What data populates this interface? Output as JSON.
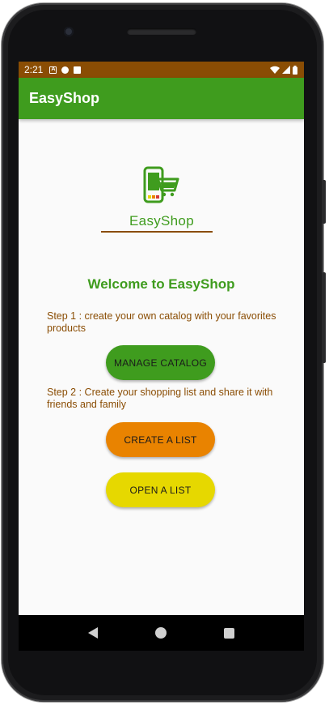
{
  "status_bar": {
    "time": "2:21",
    "icons": [
      "a-notification-icon",
      "p-notification-icon",
      "sd-card-icon",
      "wifi-icon",
      "signal-icon",
      "battery-icon"
    ]
  },
  "app_bar": {
    "title": "EasyShop"
  },
  "logo": {
    "text": "EasyShop"
  },
  "welcome": "Welcome to EasyShop",
  "step1": "Step 1 : create your own catalog with your favorites products",
  "step2": "Step 2 : Create your shopping list and share it with friends and family",
  "buttons": {
    "manage_catalog": "MANAGE CATALOG",
    "create_list": "CREATE A LIST",
    "open_list": "OPEN A LIST"
  },
  "colors": {
    "primary": "#3f9c1e",
    "status_bar": "#8a4d04",
    "step_text": "#8a4d04",
    "create_button": "#e98300",
    "open_button": "#e6d800"
  }
}
